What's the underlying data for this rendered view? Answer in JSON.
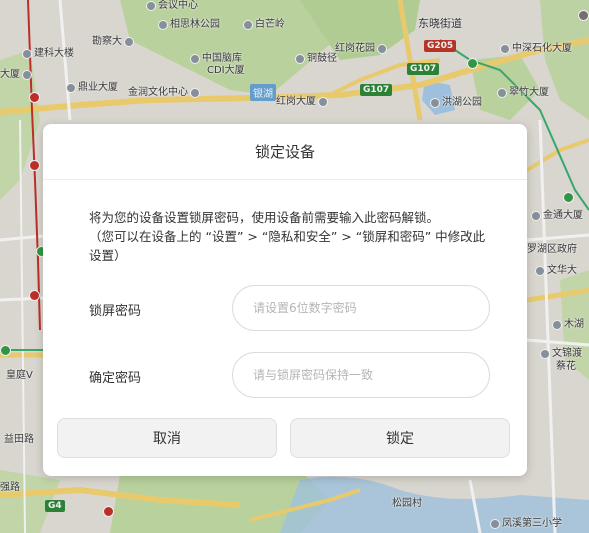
{
  "map": {
    "pois": [
      {
        "label": "相思林公园",
        "kind": "poi"
      },
      {
        "label": "白芒岭",
        "kind": "poi"
      },
      {
        "label": "勘察大",
        "kind": "poi"
      },
      {
        "label": "建科大楼",
        "kind": "poi"
      },
      {
        "label": "中国脑库",
        "kind": "poi"
      },
      {
        "label": "CDI大厦",
        "kind": "poi"
      },
      {
        "label": "铜鼓径",
        "kind": "poi"
      },
      {
        "label": "红岗花园",
        "kind": "poi"
      },
      {
        "label": "鼎业大厦",
        "kind": "poi"
      },
      {
        "label": "金润文化中心",
        "kind": "poi"
      },
      {
        "label": "红岗大厦",
        "kind": "poi"
      },
      {
        "label": "洪湖公园",
        "kind": "poi"
      },
      {
        "label": "翠竹大厦",
        "kind": "poi"
      },
      {
        "label": "中深石化大厦",
        "kind": "poi"
      },
      {
        "label": "东晓街道",
        "kind": "district"
      },
      {
        "label": "大厦",
        "kind": "poi"
      },
      {
        "label": "会议中心",
        "kind": "poi"
      },
      {
        "label": "金通大厦",
        "kind": "poi"
      },
      {
        "label": "罗湖区政府",
        "kind": "poi"
      },
      {
        "label": "文华大",
        "kind": "poi"
      },
      {
        "label": "木湖",
        "kind": "poi"
      },
      {
        "label": "文锦渡",
        "kind": "poi"
      },
      {
        "label": "蔡花",
        "kind": "poi"
      },
      {
        "label": "皇庭V",
        "kind": "poi"
      },
      {
        "label": "松园村",
        "kind": "poi"
      },
      {
        "label": "凤溪第三小学",
        "kind": "poi"
      },
      {
        "label": "益田路",
        "kind": "poi"
      },
      {
        "label": "强路",
        "kind": "poi"
      }
    ],
    "shields": [
      "G205",
      "G107",
      "G107",
      "G4"
    ],
    "lake": "银湖"
  },
  "dialog": {
    "title": "锁定设备",
    "description_line1": "将为您的设备设置锁屏密码，使用设备前需要输入此密码解锁。",
    "description_line2": "（您可以在设备上的 “设置” > “隐私和安全” > “锁屏和密码” 中修改此设置）",
    "password_label": "锁屏密码",
    "password_placeholder": "请设置6位数字密码",
    "password_value": "",
    "confirm_label": "确定密码",
    "confirm_placeholder": "请与锁屏密码保持一致",
    "confirm_value": "",
    "cancel_button": "取消",
    "lock_button": "锁定"
  },
  "colors": {
    "map_bg": "#e7e4dc",
    "park_green": "#c5dfa7",
    "road_yellow": "#f7d774",
    "water_blue": "#a9cdeb",
    "dialog_bg": "#ffffff",
    "button_bg": "#f2f2f2"
  }
}
